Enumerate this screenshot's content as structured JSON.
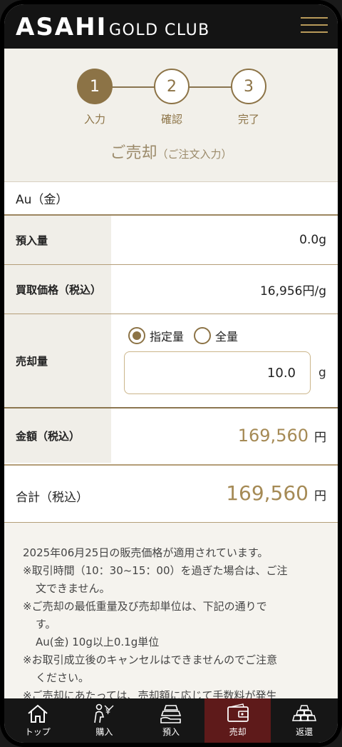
{
  "header": {
    "logo_main": "ASAHI",
    "logo_sub": "GOLD CLUB",
    "menu_icon": "hamburger-icon"
  },
  "steps": [
    {
      "number": "1",
      "label": "入力",
      "active": true
    },
    {
      "number": "2",
      "label": "確認",
      "active": false
    },
    {
      "number": "3",
      "label": "完了",
      "active": false
    }
  ],
  "page_title": {
    "main": "ご売却",
    "sub": "（ご注文入力）"
  },
  "form": {
    "metal": "Au（金）",
    "deposit_label": "預入量",
    "deposit_value": "0.0g",
    "price_label": "買取価格（税込）",
    "price_value": "16,956円/g",
    "qty_label": "売却量",
    "radio_specified": "指定量",
    "radio_all": "全量",
    "qty_value": "10.0",
    "qty_unit": "g",
    "amount_label": "金額（税込）",
    "amount_value": "169,560",
    "amount_unit": "円",
    "total_label": "合計（税込）",
    "total_value": "169,560",
    "total_unit": "円"
  },
  "notes": [
    "2025年06月25日の販売価格が適用されています。",
    "※取引時間（10：30~15：00）を過ぎた場合は、ご注",
    "文できません。",
    "※ご売却の最低重量及び売却単位は、下記の通りで",
    "す。",
    "Au(金) 10g以上0.1g単位",
    "※お取引成立後のキャンセルはできませんのでご注意",
    "ください。",
    "※ご売却にあたっては、売却額に応じて手数料が発生"
  ],
  "nav": [
    {
      "label": "トップ",
      "icon": "home-icon"
    },
    {
      "label": "購入",
      "icon": "purchase-icon"
    },
    {
      "label": "預入",
      "icon": "deposit-icon"
    },
    {
      "label": "売却",
      "icon": "wallet-icon",
      "active": true
    },
    {
      "label": "返還",
      "icon": "gold-bars-icon"
    }
  ],
  "colors": {
    "accent": "#8c7346",
    "gold_text": "#a58a55",
    "header_bg": "#141414",
    "nav_active": "#5e1a1a"
  }
}
